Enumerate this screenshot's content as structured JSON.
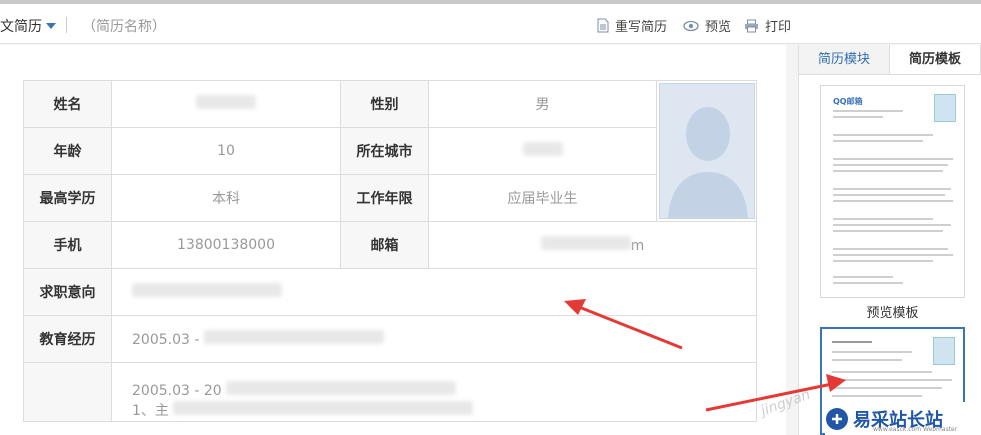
{
  "toolbar": {
    "title": "文简历",
    "name_placeholder": "（简历名称）",
    "rewrite_label": "重写简历",
    "preview_label": "预览",
    "print_label": "打印"
  },
  "resume": {
    "labels": {
      "name": "姓名",
      "gender": "性别",
      "age": "年龄",
      "city": "所在城市",
      "education": "最高学历",
      "work_years": "工作年限",
      "phone": "手机",
      "email": "邮箱",
      "intention": "求职意向",
      "edu_history": "教育经历"
    },
    "values": {
      "gender": "男",
      "age": "10",
      "education": "本科",
      "work_years": "应届毕业生",
      "phone": "13800138000",
      "email_suffix": "m",
      "edu_date": "2005.03 -",
      "work_date": "2005.03 - 20",
      "work_item": "1、主"
    }
  },
  "right_panel": {
    "tabs": [
      "简历模块",
      "简历模板"
    ],
    "active_tab": 1,
    "preview_template_label": "预览模板",
    "thumb_title": "QQ邮箱"
  },
  "watermark": {
    "brand": "易采站长站",
    "sub": "www.easck.com  Webmaster",
    "jingyan": "jingyan"
  },
  "colors": {
    "accent": "#3b73b9",
    "arrow": "#e53935"
  }
}
